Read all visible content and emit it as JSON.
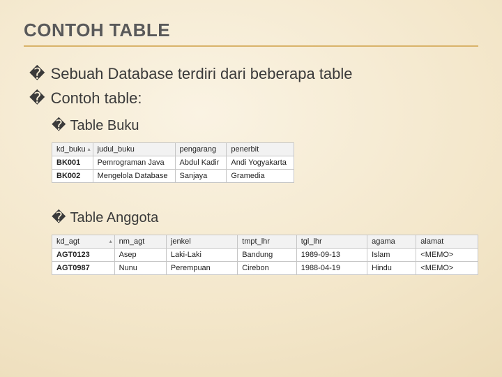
{
  "title": "CONTOH TABLE",
  "bullets": {
    "b1": "Sebuah Database terdiri dari beberapa table",
    "b2": "Contoh table:"
  },
  "sub": {
    "s1": "Table Buku",
    "s2": "Table Anggota"
  },
  "glyph": "�",
  "tableBuku": {
    "headers": [
      "kd_buku",
      "judul_buku",
      "pengarang",
      "penerbit"
    ],
    "rows": [
      [
        "BK001",
        "Pemrograman Java",
        "Abdul Kadir",
        "Andi Yogyakarta"
      ],
      [
        "BK002",
        "Mengelola Database",
        "Sanjaya",
        "Gramedia"
      ]
    ]
  },
  "tableAnggota": {
    "headers": [
      "kd_agt",
      "nm_agt",
      "jenkel",
      "tmpt_lhr",
      "tgl_lhr",
      "agama",
      "alamat"
    ],
    "rows": [
      [
        "AGT0123",
        "Asep",
        "Laki-Laki",
        "Bandung",
        "1989-09-13",
        "Islam",
        "<MEMO>"
      ],
      [
        "AGT0987",
        "Nunu",
        "Perempuan",
        "Cirebon",
        "1988-04-19",
        "Hindu",
        "<MEMO>"
      ]
    ]
  }
}
